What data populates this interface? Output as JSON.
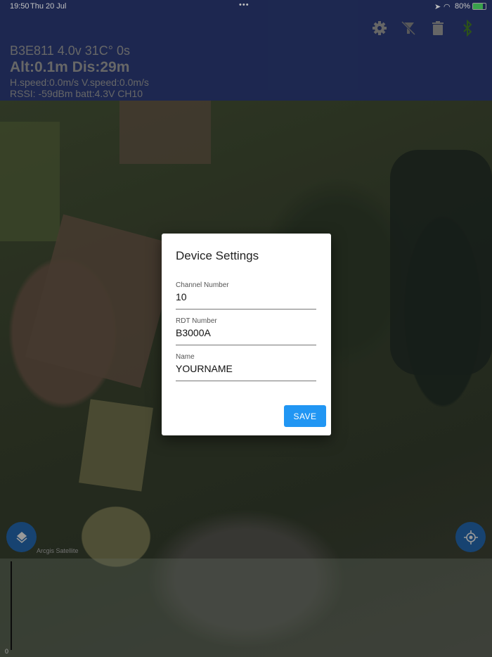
{
  "status_bar": {
    "time": "19:50",
    "date": "Thu 20 Jul",
    "dots": "•••",
    "battery": "80%"
  },
  "header": {
    "line1": "B3E811  4.0v 31C° 0s",
    "line2": "Alt:0.1m  Dis:29m",
    "line3": "H.speed:0.0m/s  V.speed:0.0m/s",
    "line4": "RSSI: -59dBm  batt:4.3V CH10"
  },
  "map": {
    "attribution": "Arcgis Satellite",
    "scale_zero": "0"
  },
  "dialog": {
    "title": "Device Settings",
    "fields": [
      {
        "label": "Channel Number",
        "value": "10"
      },
      {
        "label": "RDT Number",
        "value": "B3000A"
      },
      {
        "label": "Name",
        "value": "YOURNAME"
      }
    ],
    "save_label": "SAVE"
  },
  "colors": {
    "header": "#27356b",
    "accent": "#2196f3",
    "bluetooth": "#3b6e22",
    "fab": "#1f5a97"
  }
}
